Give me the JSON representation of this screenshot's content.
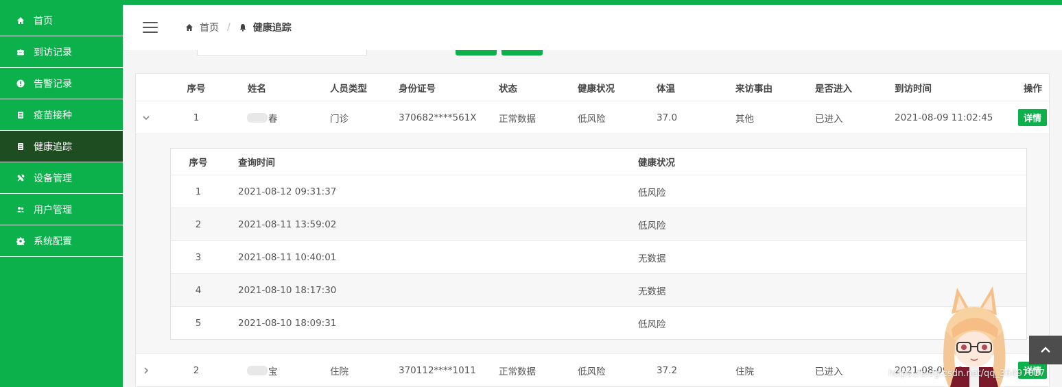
{
  "sidebar": {
    "items": [
      {
        "label": "首页",
        "icon": "home-icon"
      },
      {
        "label": "到访记录",
        "icon": "group-icon"
      },
      {
        "label": "告警记录",
        "icon": "alert-icon"
      },
      {
        "label": "疫苗接种",
        "icon": "document-icon"
      },
      {
        "label": "健康追踪",
        "icon": "document-icon",
        "active": true
      },
      {
        "label": "设备管理",
        "icon": "tools-icon"
      },
      {
        "label": "用户管理",
        "icon": "users-icon"
      },
      {
        "label": "系统配置",
        "icon": "gear-icon"
      }
    ]
  },
  "breadcrumb": {
    "home": "首页",
    "separator": "/",
    "current": "健康追踪"
  },
  "table": {
    "headers": [
      "序号",
      "姓名",
      "人员类型",
      "身份证号",
      "状态",
      "健康状况",
      "体温",
      "来访事由",
      "是否进入",
      "到访时间",
      "操作"
    ],
    "rows": [
      {
        "index": "1",
        "name_suffix": "春",
        "type": "门诊",
        "id_no": "370682****561X",
        "status": "正常数据",
        "health": "低风险",
        "temp": "37.0",
        "reason": "其他",
        "entered": "已进入",
        "visit_time": "2021-08-09 11:02:45",
        "action": "详情"
      },
      {
        "index": "2",
        "name_suffix": "宝",
        "type": "住院",
        "id_no": "370112****1011",
        "status": "正常数据",
        "health": "低风险",
        "temp": "37.2",
        "reason": "住院",
        "entered": "已进入",
        "visit_time": "2021-08-09 10",
        "action": "详情"
      }
    ]
  },
  "subtable": {
    "headers": [
      "序号",
      "查询时间",
      "健康状况"
    ],
    "rows": [
      {
        "index": "1",
        "time": "2021-08-12 09:31:37",
        "health": "低风险"
      },
      {
        "index": "2",
        "time": "2021-08-11 13:59:02",
        "health": "低风险"
      },
      {
        "index": "3",
        "time": "2021-08-11 10:40:01",
        "health": "无数据"
      },
      {
        "index": "4",
        "time": "2021-08-10 18:17:30",
        "health": "无数据"
      },
      {
        "index": "5",
        "time": "2021-08-10 18:09:31",
        "health": "低风险"
      }
    ]
  },
  "watermark": "https://blog.csdn.net/qq_36497017",
  "colors": {
    "brand": "#0cb14b",
    "active": "#1e4d21"
  }
}
